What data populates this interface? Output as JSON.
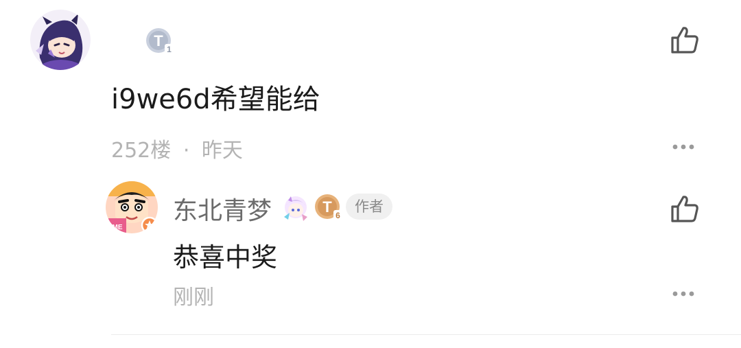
{
  "comment": {
    "level_badge": "T1",
    "text": "i9we6d希望能给",
    "floor": "252楼",
    "separator": "·",
    "time": "昨天",
    "like_icon": "thumbs-up-icon",
    "more_icon": "more-dots-icon"
  },
  "reply": {
    "username": "东北青梦",
    "level_badge": "T6",
    "author_tag": "作者",
    "text": "恭喜中奖",
    "time": "刚刚",
    "like_icon": "thumbs-up-icon",
    "more_icon": "more-dots-icon"
  },
  "colors": {
    "text_primary": "#1b1b1b",
    "text_secondary": "#b3b3b3",
    "username": "#6b6b6b",
    "badge_silver": "#c9d0de",
    "badge_bronze": "#e7b27a"
  }
}
